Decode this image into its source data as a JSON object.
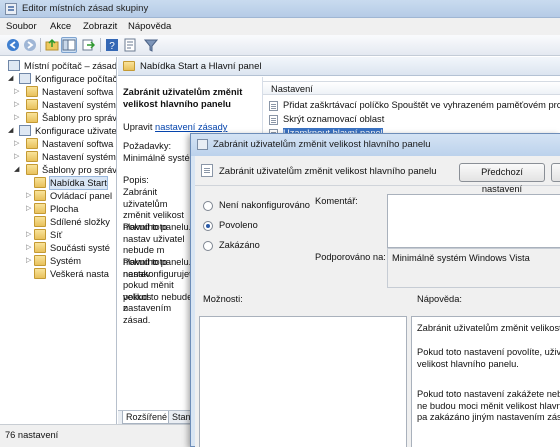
{
  "window": {
    "title": "Editor místních zásad skupiny"
  },
  "menu": [
    "Soubor",
    "Akce",
    "Zobrazit",
    "Nápověda"
  ],
  "tree": {
    "nodes": [
      {
        "label": "Místní počítač – zásady"
      },
      {
        "label": "Konfigurace počítače"
      },
      {
        "label": "Nastavení softwa"
      },
      {
        "label": "Nastavení systém"
      },
      {
        "label": "Šablony pro správ"
      },
      {
        "label": "Konfigurace uživatele"
      },
      {
        "label": "Nastavení softwa"
      },
      {
        "label": "Nastavení systém"
      },
      {
        "label": "Šablony pro správ"
      },
      {
        "label": "Nabídka Start"
      },
      {
        "label": "Ovládací panel"
      },
      {
        "label": "Plocha"
      },
      {
        "label": "Sdílené složky"
      },
      {
        "label": "Síť"
      },
      {
        "label": "Součásti systé"
      },
      {
        "label": "Systém"
      },
      {
        "label": "Veškerá nasta"
      }
    ]
  },
  "category": {
    "title": "Nabídka Start a Hlavní panel"
  },
  "description": {
    "heading": "Zabránit uživatelům změnit velikost hlavního panelu",
    "edit_prefix": "Upravit",
    "edit_link": "nastavení zásady",
    "req_label": "Požadavky:",
    "req_value": "Minimálně systém",
    "desc_label": "Popis:",
    "p1": "Zabránit uživatelům změnit velikost hlavního panelu.",
    "p2": "Pokud toto nastav uživatel nebude m hlavního panelu.",
    "p3": "Pokud toto nastav nenakonfigurujete nebo ho zakážete, mohou měnit velikost hlavního panelu, pokud to nebude zakázáno jiným nastavením zásad.",
    "p3_lines": [
      "Pokud toto nastav",
      "nenakonfigurujete",
      "pokud měnit velikos",
      "pokud to nebude z",
      "nastavením zásad."
    ]
  },
  "list": {
    "header": "Nastavení",
    "rows": [
      {
        "label": "Přidat zaškrtávací políčko Spouštět ve vyhrazeném paměťovém prosto"
      },
      {
        "label": "Skrýt oznamovací oblast"
      },
      {
        "label": "Uzamknout hlavní panel"
      }
    ]
  },
  "tabs": [
    "Rozšířené",
    "Stand"
  ],
  "status": {
    "text": "76 nastavení"
  },
  "dialog": {
    "title": "Zabránit uživatelům změnit velikost hlavního panelu",
    "setting_name": "Zabránit uživatelům změnit velikost hlavního panelu",
    "prev_button": "Předchozí nastavení",
    "radios": [
      {
        "label": "Není nakonfigurováno",
        "selected": false
      },
      {
        "label": "Povoleno",
        "selected": true
      },
      {
        "label": "Zakázáno",
        "selected": false
      }
    ],
    "comment_label": "Komentář:",
    "supported_label": "Podporováno na:",
    "supported_value": "Minimálně systém Windows Vista",
    "options_label": "Možnosti:",
    "help_label": "Nápověda:",
    "help_p1": "Zabránit uživatelům změnit velikost",
    "help_p2": "Pokud toto nastavení povolíte, uživatel velikost hlavního panelu.",
    "help_p3": "Pokud toto nastavení zakážete nebo ne budou moci měnit velikost hlavního pa zakázáno jiným nastavením zásad."
  }
}
